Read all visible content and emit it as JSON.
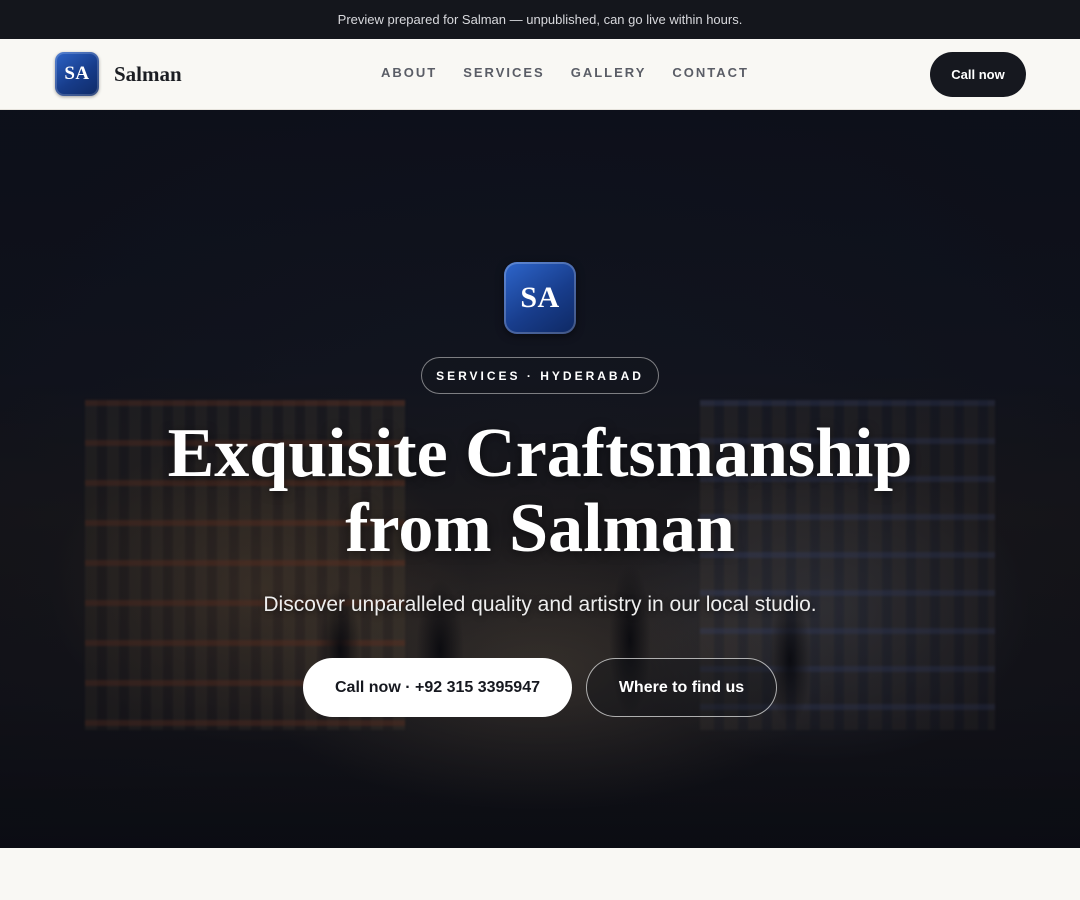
{
  "preview_banner": {
    "text": "Preview prepared for Salman — unpublished, can go live within hours."
  },
  "header": {
    "logo_initials": "SA",
    "brand_name": "Salman",
    "nav": [
      {
        "label": "ABOUT"
      },
      {
        "label": "SERVICES"
      },
      {
        "label": "GALLERY"
      },
      {
        "label": "CONTACT"
      }
    ],
    "call_label": "Call now"
  },
  "hero": {
    "logo_initials": "SA",
    "eyebrow": "SERVICES · HYDERABAD",
    "title_line1": "Exquisite Craftsmanship",
    "title_line2": "from Salman",
    "subtitle": "Discover unparalleled quality and artistry in our local studio.",
    "primary_cta": "Call now · +92 315 3395947",
    "secondary_cta": "Where to find us"
  },
  "colors": {
    "banner_bg": "#14161c",
    "page_bg": "#f9f8f4",
    "badge_blue": "#1a4496",
    "dark_button": "#16181f"
  }
}
